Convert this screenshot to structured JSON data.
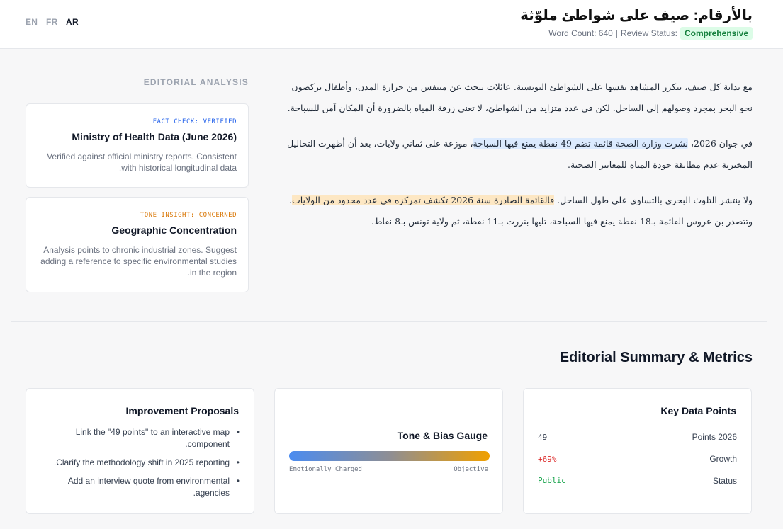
{
  "languages": [
    {
      "label": "EN",
      "active": false
    },
    {
      "label": "FR",
      "active": false
    },
    {
      "label": "AR",
      "active": true
    }
  ],
  "header": {
    "title": "بالأرقام: صيف على شواطئ ملوّثة",
    "word_count": "Word Count: 640",
    "separator": "|",
    "review_label": "Review Status:",
    "review_status": "Comprehensive"
  },
  "article": {
    "p1": "مع بداية كل صيف، تتكرر المشاهد نفسها على الشواطئ التونسية. عائلات تبحث عن متنفس من حرارة المدن، وأطفال يركضون نحو البحر بمجرد وصولهم إلى الساحل. لكن في عدد متزايد من الشواطئ، لا تعني زرقة المياه بالضرورة أن المكان آمن للسباحة.",
    "p2_before": "في جوان 2026، ",
    "p2_highlight": "نشرت وزارة الصحة قائمة تضم 49 نقطة يمنع فيها السباحة",
    "p2_after": "، موزعة على ثماني ولايات، بعد أن أظهرت التحاليل المخبرية عدم مطابقة جودة المياه للمعايير الصحية.",
    "p3_before": "ولا ينتشر التلوث البحري بالتساوي على طول الساحل. ",
    "p3_highlight": "فالقائمة الصادرة سنة 2026 تكشف تمركزه في عدد محدود من الولايات",
    "p3_after": ". وتتصدر بن عروس القائمة بـ18 نقطة يمنع فيها السباحة، تليها بنزرت بـ11 نقطة، ثم ولاية تونس بـ8 نقاط."
  },
  "analysis": {
    "heading": "EDITORIAL ANALYSIS",
    "notes": [
      {
        "tag": "FACT CHECK: VERIFIED",
        "title": "Ministry of Health Data (June 2026)",
        "body": "Verified against official ministry reports. Consistent with historical longitudinal data."
      },
      {
        "tag": "TONE INSIGHT: CONCERNED",
        "title": "Geographic Concentration",
        "body": "Analysis points to chronic industrial zones. Suggest adding a reference to specific environmental studies in the region."
      }
    ]
  },
  "summary": {
    "title": "Editorial Summary & Metrics",
    "proposals": {
      "title": "Improvement Proposals",
      "items": [
        "Link the \"49 points\" to an interactive map component.",
        "Clarify the methodology shift in 2025 reporting.",
        "Add an interview quote from environmental agencies."
      ]
    },
    "gauge": {
      "title": "Tone & Bias Gauge",
      "left_label": "Emotionally Charged",
      "right_label": "Objective",
      "colors": [
        "#4b8cf0",
        "#8e8e94",
        "#f0a000"
      ]
    },
    "data_points": {
      "title": "Key Data Points",
      "rows": [
        {
          "label": "Points 2026",
          "value": "49",
          "color": "#374151"
        },
        {
          "label": "Growth",
          "value": "+69%",
          "color": "#dc2626"
        },
        {
          "label": "Status",
          "value": "Public",
          "color": "#16a34a"
        }
      ]
    }
  }
}
